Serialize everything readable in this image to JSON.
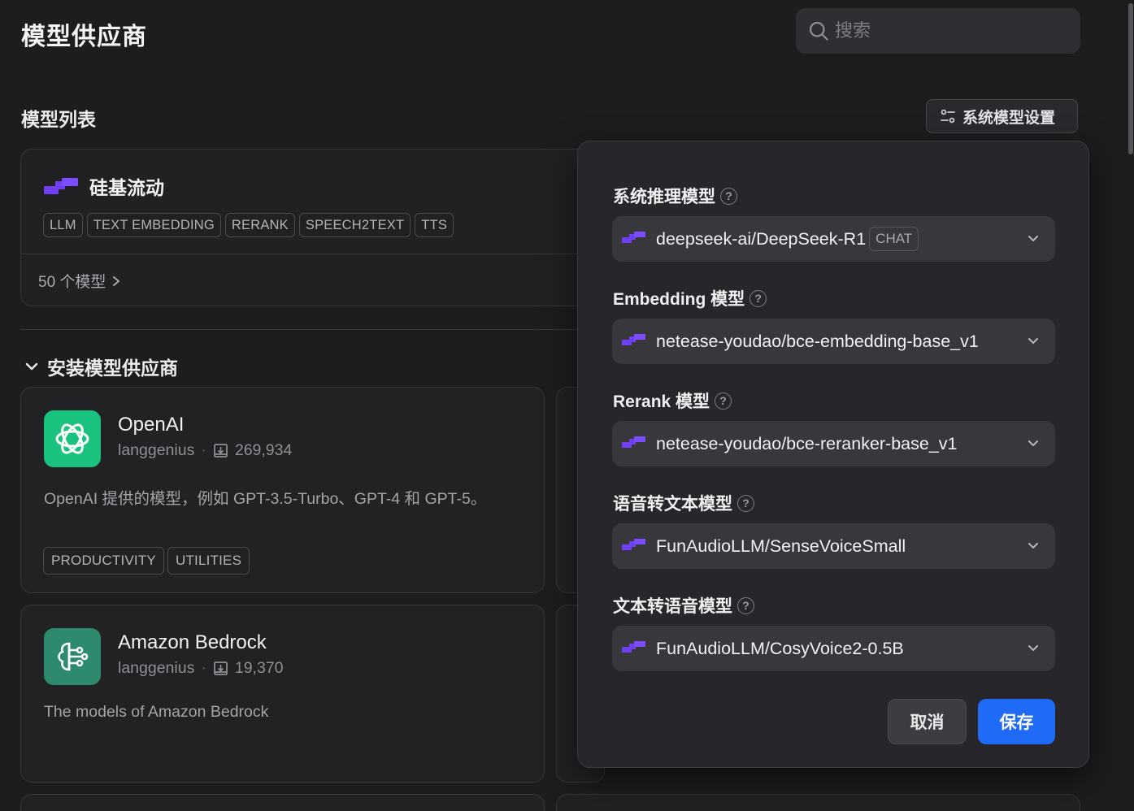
{
  "header": {
    "title": "模型供应商",
    "search_placeholder": "搜索"
  },
  "model_list": {
    "title": "模型列表",
    "system_settings_label": "系统模型设置"
  },
  "provider": {
    "name": "硅基流动",
    "tags": [
      "LLM",
      "TEXT EMBEDDING",
      "RERANK",
      "SPEECH2TEXT",
      "TTS"
    ],
    "model_count": "50 个模型"
  },
  "install": {
    "title": "安装模型供应商",
    "plugins": [
      {
        "name": "OpenAI",
        "author": "langgenius",
        "installs": "269,934",
        "description": "OpenAI 提供的模型，例如 GPT-3.5-Turbo、GPT-4 和 GPT-5。",
        "tags": [
          "PRODUCTIVITY",
          "UTILITIES"
        ],
        "icon": "openai-icon",
        "icon_bg": "#19c37d"
      },
      {
        "name": "Amazon Bedrock",
        "author": "langgenius",
        "installs": "19,370",
        "description": "The models of Amazon Bedrock",
        "tags": [],
        "icon": "bedrock-icon",
        "icon_bg": "#2e8a6e"
      }
    ]
  },
  "system_models": {
    "fields": [
      {
        "label": "系统推理模型",
        "value": "deepseek-ai/DeepSeek-R1",
        "chip": "CHAT"
      },
      {
        "label": "Embedding 模型",
        "value": "netease-youdao/bce-embedding-base_v1"
      },
      {
        "label": "Rerank 模型",
        "value": "netease-youdao/bce-reranker-base_v1"
      },
      {
        "label": "语音转文本模型",
        "value": "FunAudioLLM/SenseVoiceSmall"
      },
      {
        "label": "文本转语音模型",
        "value": "FunAudioLLM/CosyVoice2-0.5B"
      }
    ],
    "cancel_label": "取消",
    "save_label": "保存"
  },
  "colors": {
    "accent": "#1f6bf5",
    "brand_purple": "#6e3ff3",
    "background": "#1d1d20"
  }
}
